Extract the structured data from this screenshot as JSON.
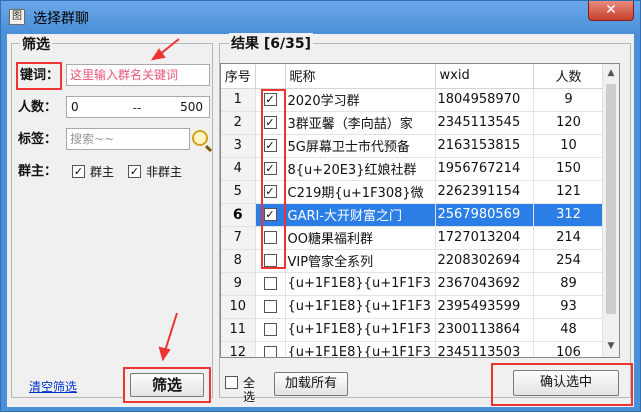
{
  "window": {
    "title": "选择群聊",
    "close_glyph": "✕",
    "app_icon_glyph": "图"
  },
  "filter": {
    "legend": "筛选",
    "keyword_label": "键词：",
    "keyword_placeholder": "这里输入群名关键词",
    "count_label": "人数：",
    "count_min": "0",
    "count_dash": "--",
    "count_max": "500",
    "tag_label": "标签：",
    "tag_placeholder": "搜索~~",
    "owner_label": "群主：",
    "owner_option": "群主",
    "non_owner_option": "非群主",
    "clear_link": "清空筛选",
    "filter_button": "筛选"
  },
  "results": {
    "legend": "结果 [6/35]",
    "columns": [
      "序号",
      "",
      "昵称",
      "wxid",
      "人数"
    ],
    "rows": [
      {
        "index": "1",
        "checked": true,
        "name": "2020学习群",
        "wxid": "1804958970",
        "count": "9"
      },
      {
        "index": "2",
        "checked": true,
        "name": "3群亚馨（李向喆）家",
        "wxid": "2345113545",
        "count": "120"
      },
      {
        "index": "3",
        "checked": true,
        "name": "5G屏幕卫士市代预备",
        "wxid": "2163153815",
        "count": "10"
      },
      {
        "index": "4",
        "checked": true,
        "name": "8{u+20E3}红娘社群",
        "wxid": "1956767214",
        "count": "150"
      },
      {
        "index": "5",
        "checked": true,
        "name": "C219期{u+1F308}微",
        "wxid": "2262391154",
        "count": "121"
      },
      {
        "index": "6",
        "checked": true,
        "name": "GARI-大开财富之门",
        "wxid": "2567980569",
        "count": "312"
      },
      {
        "index": "7",
        "checked": false,
        "name": "OO糖果福利群",
        "wxid": "1727013204",
        "count": "214"
      },
      {
        "index": "8",
        "checked": false,
        "name": "VIP管家全系列",
        "wxid": "2208302694",
        "count": "254"
      },
      {
        "index": "9",
        "checked": false,
        "name": "{u+1F1E8}{u+1F1F3",
        "wxid": "2367043692",
        "count": "89"
      },
      {
        "index": "10",
        "checked": false,
        "name": "{u+1F1E8}{u+1F1F3",
        "wxid": "2395493599",
        "count": "93"
      },
      {
        "index": "11",
        "checked": false,
        "name": "{u+1F1E8}{u+1F1F3",
        "wxid": "2300113864",
        "count": "48"
      },
      {
        "index": "12",
        "checked": false,
        "name": "{u+1F1E8}{u+1F1F3",
        "wxid": "2345113503",
        "count": "106"
      }
    ],
    "select_all": "全选",
    "load_all_button": "加载所有",
    "confirm_button": "确认选中"
  },
  "colors": {
    "title_blue": "#4a90d9",
    "selection_blue": "#2b7ee6",
    "annotation_red": "#ee3333"
  }
}
